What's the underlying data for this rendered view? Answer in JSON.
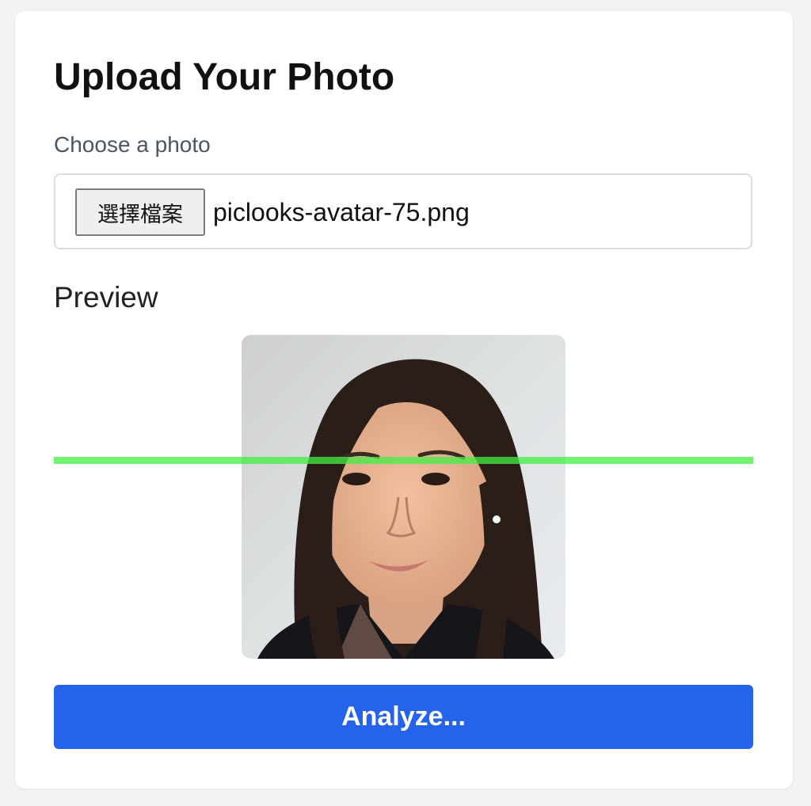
{
  "upload": {
    "title": "Upload Your Photo",
    "choose_label": "Choose a photo",
    "file_button_label": "選擇檔案",
    "file_name": "piclooks-avatar-75.png"
  },
  "preview": {
    "label": "Preview"
  },
  "analyze": {
    "button_label": "Analyze..."
  },
  "colors": {
    "accent": "#2563eb",
    "scan_line": "#44ee44",
    "page_background": "#f3f3f3",
    "card_background": "#ffffff"
  }
}
